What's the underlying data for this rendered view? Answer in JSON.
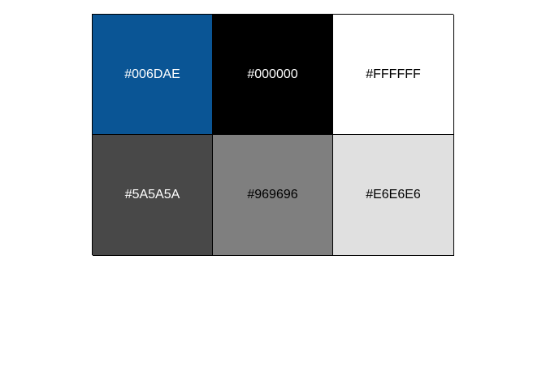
{
  "palette": {
    "swatches": [
      {
        "label": "#006DAE",
        "fill": "#0A5595",
        "text_color": "#FFFFFF"
      },
      {
        "label": "#000000",
        "fill": "#000000",
        "text_color": "#FFFFFF"
      },
      {
        "label": "#FFFFFF",
        "fill": "#FFFFFF",
        "text_color": "#000000"
      },
      {
        "label": "#5A5A5A",
        "fill": "#484848",
        "text_color": "#FFFFFF"
      },
      {
        "label": "#969696",
        "fill": "#7F7F7F",
        "text_color": "#000000"
      },
      {
        "label": "#E6E6E6",
        "fill": "#E0E0E0",
        "text_color": "#000000"
      }
    ]
  }
}
